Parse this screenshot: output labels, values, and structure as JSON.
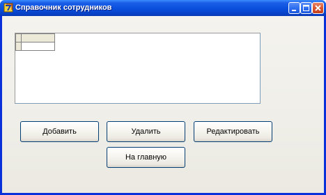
{
  "window": {
    "title": "Справочник сотрудников",
    "controls": {
      "minimize_icon": "minimize-icon",
      "maximize_icon": "maximize-icon",
      "close_icon": "close-icon"
    }
  },
  "grid": {
    "rows": [
      [
        "",
        ""
      ],
      [
        "",
        ""
      ]
    ]
  },
  "buttons": {
    "add": "Добавить",
    "delete": "Удалить",
    "edit": "Редактировать",
    "home": "На главную"
  },
  "colors": {
    "titlebar": "#0a4fdc",
    "window_frame": "#0831d9",
    "close_button": "#d9552f",
    "button_border": "#003c74"
  }
}
